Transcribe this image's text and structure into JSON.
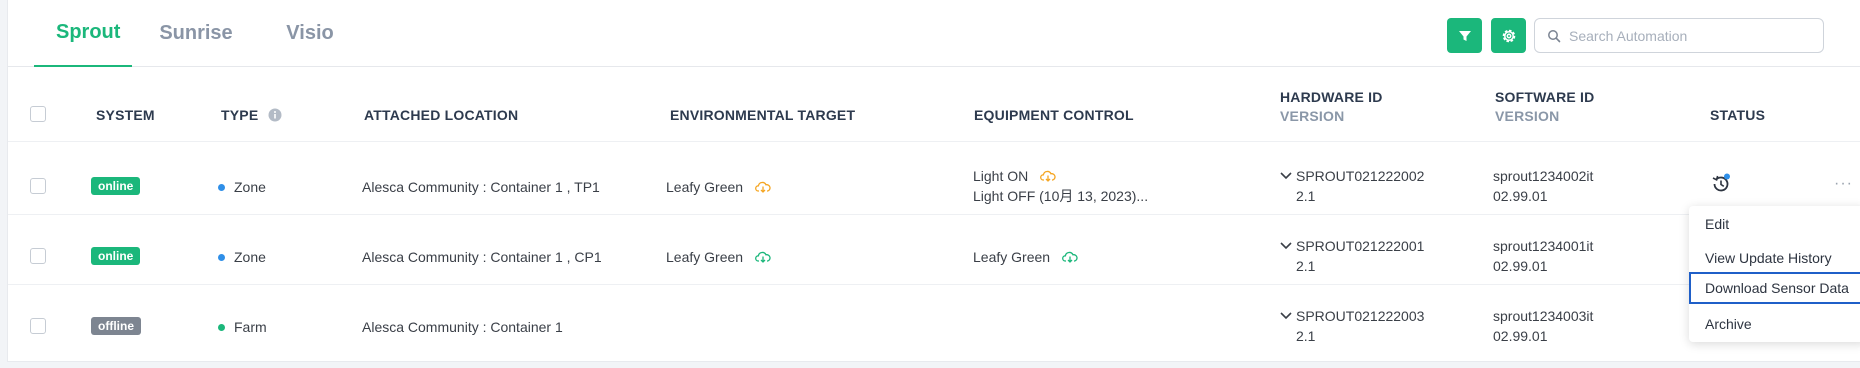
{
  "tabs": [
    {
      "label": "Sprout",
      "active": true
    },
    {
      "label": "Sunrise",
      "active": false
    },
    {
      "label": "Visio",
      "active": false
    }
  ],
  "toolbar": {
    "filter_icon": "filter-icon",
    "settings_icon": "gear-icon",
    "search_placeholder": "Search Automation"
  },
  "columns": {
    "system": "SYSTEM",
    "type": "TYPE",
    "attached_location": "ATTACHED LOCATION",
    "environmental_target": "ENVIRONMENTAL TARGET",
    "equipment_control": "EQUIPMENT CONTROL",
    "hardware_id": "HARDWARE ID",
    "hardware_version": "VERSION",
    "software_id": "SOFTWARE ID",
    "software_version": "VERSION",
    "status": "STATUS"
  },
  "rows": [
    {
      "system": "online",
      "type": "Zone",
      "type_color": "#2f8fe8",
      "location": "Alesca Community : Container 1 , TP1",
      "env_target": "Leafy Green",
      "env_cloud_color": "#f5a623",
      "equip_line1": "Light ON",
      "equip_line1_cloud_color": "#f5a623",
      "equip_line2": "Light OFF (10月 13, 2023)...",
      "hardware_id": "SPROUT021222002",
      "hardware_version": "2.1",
      "software_id": "sprout1234002it",
      "software_version": "02.99.01"
    },
    {
      "system": "online",
      "type": "Zone",
      "type_color": "#2f8fe8",
      "location": "Alesca Community : Container 1 , CP1",
      "env_target": "Leafy Green",
      "env_cloud_color": "#1bb77b",
      "equip_line1": "Leafy Green",
      "equip_line1_cloud_color": "#1bb77b",
      "equip_line2": "",
      "hardware_id": "SPROUT021222001",
      "hardware_version": "2.1",
      "software_id": "sprout1234001it",
      "software_version": "02.99.01"
    },
    {
      "system": "offline",
      "type": "Farm",
      "type_color": "#1bb77b",
      "location": "Alesca Community : Container 1",
      "env_target": "",
      "equip_line1": "",
      "equip_line2": "",
      "hardware_id": "SPROUT021222003",
      "hardware_version": "2.1",
      "software_id": "sprout1234003it",
      "software_version": "02.99.01"
    }
  ],
  "more_label": "···",
  "menu": {
    "items": [
      "Edit",
      "View Update History",
      "Download Sensor Data",
      "Archive"
    ]
  },
  "colors": {
    "accent": "#1bb77b",
    "offline": "#7d8591",
    "focus": "#1f5fc8"
  }
}
